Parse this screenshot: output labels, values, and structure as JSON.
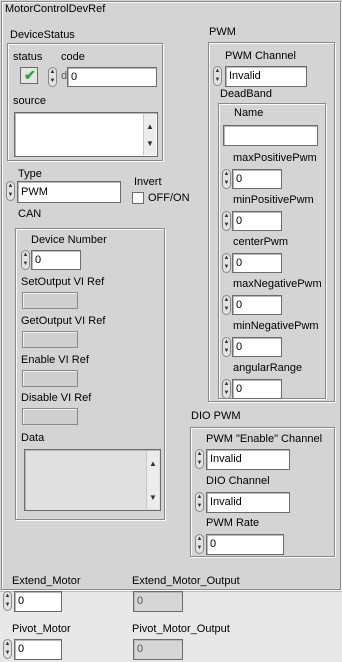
{
  "window": {
    "title": "MotorControlDevRef"
  },
  "device_status": {
    "label": "DeviceStatus",
    "status_label": "status",
    "code_label": "code",
    "code_value": "0",
    "code_radix": "d",
    "source_label": "source",
    "status_icon": "checkmark-icon"
  },
  "type": {
    "label": "Type",
    "value": "PWM"
  },
  "invert": {
    "label": "Invert",
    "option": "OFF/ON"
  },
  "can": {
    "label": "CAN",
    "device_number_label": "Device Number",
    "device_number": "0",
    "set_output_label": "SetOutput VI Ref",
    "get_output_label": "GetOutput VI Ref",
    "enable_label": "Enable VI Ref",
    "disable_label": "Disable VI Ref",
    "data_label": "Data"
  },
  "pwm": {
    "label": "PWM",
    "channel_label": "PWM Channel",
    "channel_value": "Invalid",
    "deadband_label": "DeadBand",
    "name_label": "Name",
    "name_value": "",
    "fields": [
      {
        "label": "maxPositivePwm",
        "value": "0"
      },
      {
        "label": "minPositivePwm",
        "value": "0"
      },
      {
        "label": "centerPwm",
        "value": "0"
      },
      {
        "label": "maxNegativePwm",
        "value": "0"
      },
      {
        "label": "minNegativePwm",
        "value": "0"
      },
      {
        "label": "angularRange",
        "value": "0"
      }
    ]
  },
  "dio_pwm": {
    "label": "DIO PWM",
    "enable_channel_label": "PWM \"Enable\" Channel",
    "enable_channel_value": "Invalid",
    "dio_channel_label": "DIO Channel",
    "dio_channel_value": "Invalid",
    "rate_label": "PWM Rate",
    "rate_value": "0"
  },
  "bottom": {
    "extend_motor_label": "Extend_Motor",
    "extend_motor_value": "0",
    "extend_output_label": "Extend_Motor_Output",
    "extend_output_value": "0",
    "pivot_motor_label": "Pivot_Motor",
    "pivot_motor_value": "0",
    "pivot_output_label": "Pivot_Motor_Output",
    "pivot_output_value": "0"
  }
}
